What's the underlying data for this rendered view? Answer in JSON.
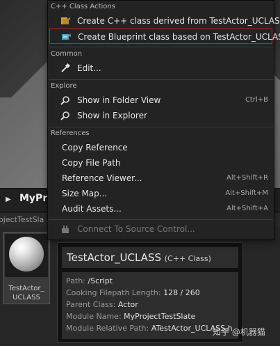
{
  "context_menu": {
    "sections": [
      {
        "header": "C++ Class Actions",
        "items": [
          {
            "label": "Create C++ class derived from TestActor_UCLASS",
            "icon": "cpp-class-icon"
          },
          {
            "label": "Create Blueprint class based on TestActor_UCLASS",
            "icon": "blueprint-class-icon",
            "highlighted": true
          }
        ]
      },
      {
        "header": "Common",
        "items": [
          {
            "label": "Edit...",
            "icon": "edit-icon"
          }
        ]
      },
      {
        "header": "Explore",
        "items": [
          {
            "label": "Show in Folder View",
            "icon": "search-icon",
            "shortcut": "Ctrl+B"
          },
          {
            "label": "Show in Explorer",
            "icon": "search-icon"
          }
        ]
      },
      {
        "header": "References",
        "items": [
          {
            "label": "Copy Reference"
          },
          {
            "label": "Copy File Path"
          },
          {
            "label": "Reference Viewer...",
            "shortcut": "Alt+Shift+R"
          },
          {
            "label": "Size Map...",
            "shortcut": "Alt+Shift+M"
          },
          {
            "label": "Audit Assets...",
            "shortcut": "Alt+Shift+A"
          }
        ]
      },
      {
        "items": [
          {
            "label": "Connect To Source Control...",
            "icon": "source-control-icon",
            "disabled": true
          }
        ]
      }
    ]
  },
  "content_browser": {
    "title": "MyPro",
    "path_fragment": "ojectTestSla"
  },
  "asset": {
    "label": "TestActor_ UCLASS"
  },
  "tooltip": {
    "name": "TestActor_UCLASS",
    "kind": "(C++ Class)",
    "rows": [
      {
        "key": "Path:",
        "value": "/Script"
      },
      {
        "key": "Cooking Filepath Length:",
        "value": "128 / 260"
      },
      {
        "key": "Parent Class:",
        "value": "Actor"
      },
      {
        "key": "Module Name:",
        "value": "MyProjectTestSlate"
      },
      {
        "key": "Module Relative Path:",
        "value": "ATestActor_UCLASS.h"
      }
    ]
  },
  "watermark": "知乎 @机器猫",
  "colors": {
    "menu_bg": "#232323",
    "highlight_border": "#d21c1c",
    "text": "#e6e6e6"
  }
}
